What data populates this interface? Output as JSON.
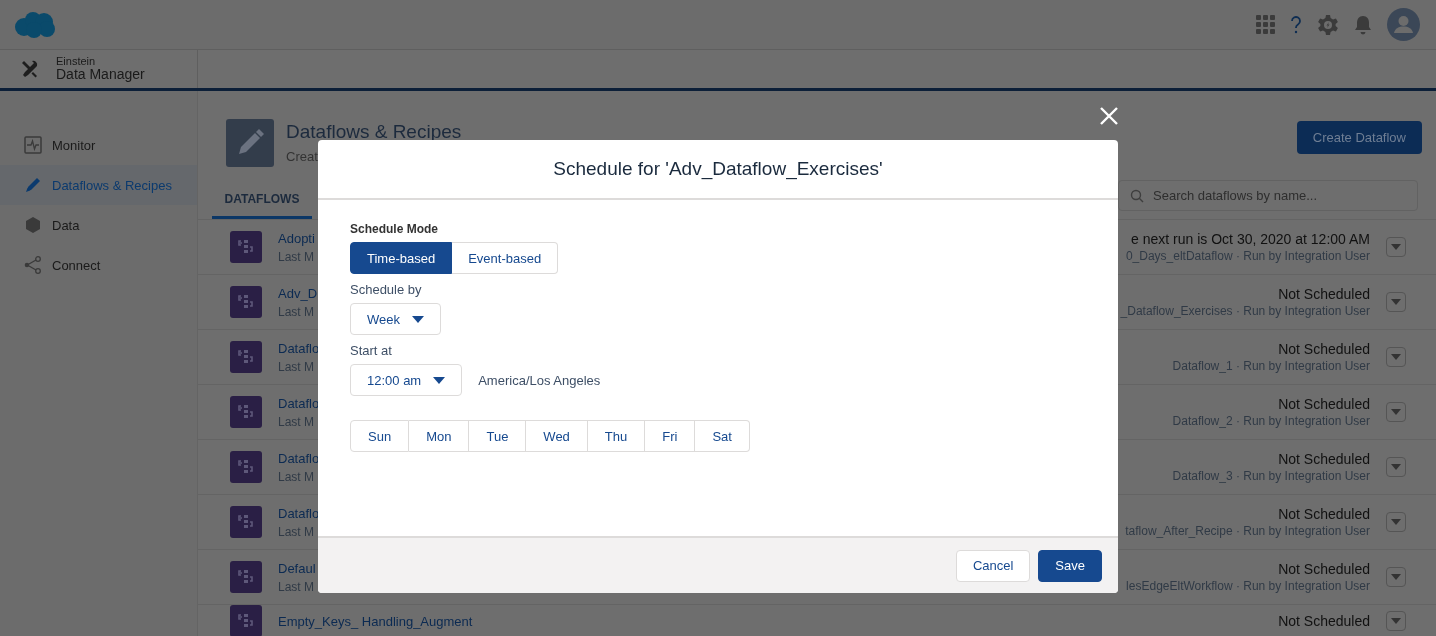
{
  "app": {
    "title_top": "Einstein",
    "title_bottom": "Data Manager"
  },
  "sidebar": {
    "items": [
      {
        "label": "Monitor",
        "selected": false
      },
      {
        "label": "Dataflows & Recipes",
        "selected": true
      },
      {
        "label": "Data",
        "selected": false
      },
      {
        "label": "Connect",
        "selected": false
      }
    ]
  },
  "page_header": {
    "title": "Dataflows & Recipes",
    "subtitle": "Creat",
    "create_button": "Create Dataflow"
  },
  "tabs": [
    {
      "label": "DATAFLOWS",
      "selected": true
    }
  ],
  "search": {
    "placeholder": "Search dataflows by name..."
  },
  "rows": [
    {
      "name": "Adopti",
      "meta": "Last M",
      "status": "e next run is Oct 30, 2020 at 12:00 AM",
      "detail": "0_Days_eltDataflow · Run by Integration User"
    },
    {
      "name": "Adv_D",
      "meta": "Last M",
      "status": "Not Scheduled",
      "detail": "_Dataflow_Exercises · Run by Integration User"
    },
    {
      "name": "Dataflo",
      "meta": "Last M",
      "status": "Not Scheduled",
      "detail": "Dataflow_1 · Run by Integration User"
    },
    {
      "name": "Dataflo",
      "meta": "Last M",
      "status": "Not Scheduled",
      "detail": "Dataflow_2 · Run by Integration User"
    },
    {
      "name": "Dataflo",
      "meta": "Last M",
      "status": "Not Scheduled",
      "detail": "Dataflow_3 · Run by Integration User"
    },
    {
      "name": "Dataflo",
      "meta": "Last M",
      "status": "Not Scheduled",
      "detail": "taflow_After_Recipe · Run by Integration User"
    },
    {
      "name": "Defaul",
      "meta": "Last M",
      "status": "Not Scheduled",
      "detail": "lesEdgeEltWorkflow · Run by Integration User"
    },
    {
      "name": "Empty_Keys_ Handling_Augment",
      "status": "Not Scheduled"
    }
  ],
  "modal": {
    "title": "Schedule for 'Adv_Dataflow_Exercises'",
    "mode_label": "Schedule Mode",
    "modes": [
      {
        "label": "Time-based",
        "selected": true
      },
      {
        "label": "Event-based",
        "selected": false
      }
    ],
    "schedule_by_label": "Schedule by",
    "schedule_by_value": "Week",
    "start_at_label": "Start at",
    "start_at_value": "12:00 am",
    "timezone": "America/Los Angeles",
    "days": [
      {
        "label": "Sun",
        "selected": false
      },
      {
        "label": "Mon",
        "selected": false
      },
      {
        "label": "Tue",
        "selected": false
      },
      {
        "label": "Wed",
        "selected": false
      },
      {
        "label": "Thu",
        "selected": false
      },
      {
        "label": "Fri",
        "selected": false
      },
      {
        "label": "Sat",
        "selected": false
      }
    ],
    "cancel": "Cancel",
    "save": "Save"
  }
}
